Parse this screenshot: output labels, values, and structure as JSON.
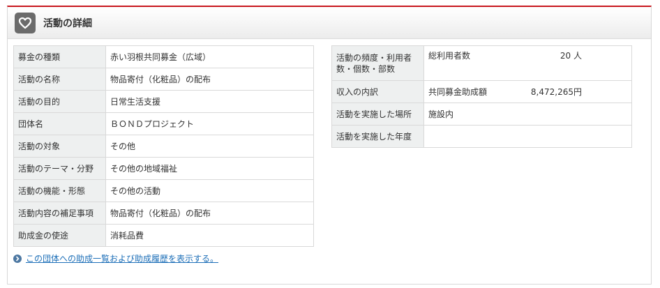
{
  "panel": {
    "title": "活動の詳細",
    "accent_color": "#c8161d"
  },
  "left_rows": [
    {
      "label": "募金の種類",
      "value": "赤い羽根共同募金（広域）"
    },
    {
      "label": "活動の名称",
      "value": "物品寄付（化粧品）の配布"
    },
    {
      "label": "活動の目的",
      "value": "日常生活支援"
    },
    {
      "label": "団体名",
      "value": "ＢＯＮＤプロジェクト"
    },
    {
      "label": "活動の対象",
      "value": "その他"
    },
    {
      "label": "活動のテーマ・分野",
      "value": "その他の地域福祉"
    },
    {
      "label": "活動の機能・形態",
      "value": "その他の活動"
    },
    {
      "label": "活動内容の補足事項",
      "value": "物品寄付（化粧品）の配布"
    },
    {
      "label": "助成金の使途",
      "value": "消耗品費"
    }
  ],
  "right_rows": {
    "frequency": {
      "label": "活動の頻度・利用者数・個数・部数",
      "key": "総利用者数",
      "value": "20 人"
    },
    "income": {
      "label": "収入の内訳",
      "key": "共同募金助成額",
      "value": "8,472,265円"
    },
    "place": {
      "label": "活動を実施した場所",
      "value": "施設内"
    },
    "year": {
      "label": "活動を実施した年度",
      "value": ""
    }
  },
  "link": {
    "text": "この団体への助成一覧および助成履歴を表示する。"
  },
  "icons": {
    "header": "heart-icon",
    "link": "chevron-right-icon"
  }
}
